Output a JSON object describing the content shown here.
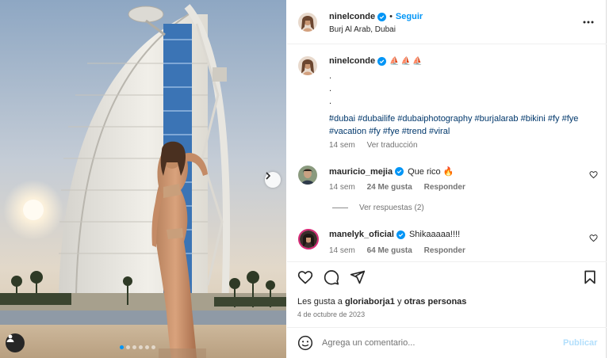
{
  "post": {
    "author": "ninelconde",
    "follow_label": "Seguir",
    "separator": "•",
    "location": "Burj Al Arab, Dubai",
    "caption": {
      "author": "ninelconde",
      "emojis": "⛵⛵⛵",
      "dot_lines": [
        ".",
        ".",
        ".",
        "."
      ],
      "hashtags": [
        "#dubai",
        "#dubailife",
        "#dubaiphotography",
        "#burjalarab",
        "#bikini",
        "#fy",
        "#fye",
        "#vacation",
        "#fy",
        "#fye",
        "#trend",
        "#viral"
      ],
      "time": "14 sem",
      "translate_label": "Ver traducción"
    },
    "comments": [
      {
        "user": "mauricio_mejia",
        "text": "Que rico 🔥",
        "time": "14 sem",
        "likes": "24 Me gusta",
        "reply_label": "Responder"
      },
      {
        "user": "manelyk_oficial",
        "text": "Shikaaaaa!!!!",
        "time": "14 sem",
        "likes": "64 Me gusta",
        "reply_label": "Responder"
      }
    ],
    "view_replies_label": "Ver respuestas (2)",
    "likes": {
      "prefix": "Les gusta a ",
      "user": "gloriaborja1",
      "middle": " y ",
      "others": "otras personas"
    },
    "date": "4 de octubre de 2023",
    "comment_placeholder": "Agrega un comentario...",
    "publish_label": "Publicar",
    "carousel": {
      "slide_count": 6,
      "active_index": 0
    }
  },
  "colors": {
    "accent": "#0095f6",
    "hashtag": "#00376b",
    "muted": "#737373",
    "publish_disabled": "#b2dffc"
  },
  "icons": [
    "more-horizontal-icon",
    "verified-badge-icon",
    "heart-icon",
    "comment-icon",
    "share-icon",
    "bookmark-icon",
    "emoji-icon",
    "tag-person-icon",
    "chevron-right-icon"
  ]
}
